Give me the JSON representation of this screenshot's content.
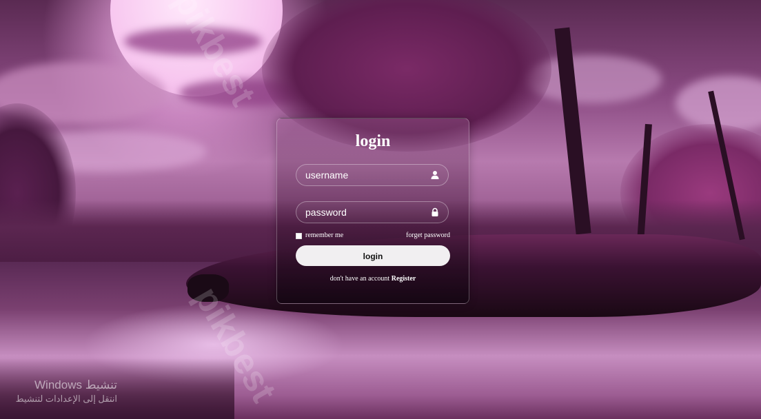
{
  "login_card": {
    "title": "login",
    "username": {
      "placeholder": "username",
      "icon": "user-icon"
    },
    "password": {
      "placeholder": "password",
      "icon": "lock-icon"
    },
    "remember_label": "remember me",
    "remember_checked": false,
    "forgot_label": "forget password",
    "submit_label": "login",
    "register_prompt": "don't have an account",
    "register_link": "Register"
  },
  "watermark": "pikbest",
  "os_overlay": {
    "line1": "Windows تنشيط",
    "line2": "انتقل إلى الإعدادات لتنشيط"
  },
  "colors": {
    "card_border": "#ffffff",
    "button_bg": "#f1eff1",
    "accent_purple": "#9a3a7e"
  }
}
